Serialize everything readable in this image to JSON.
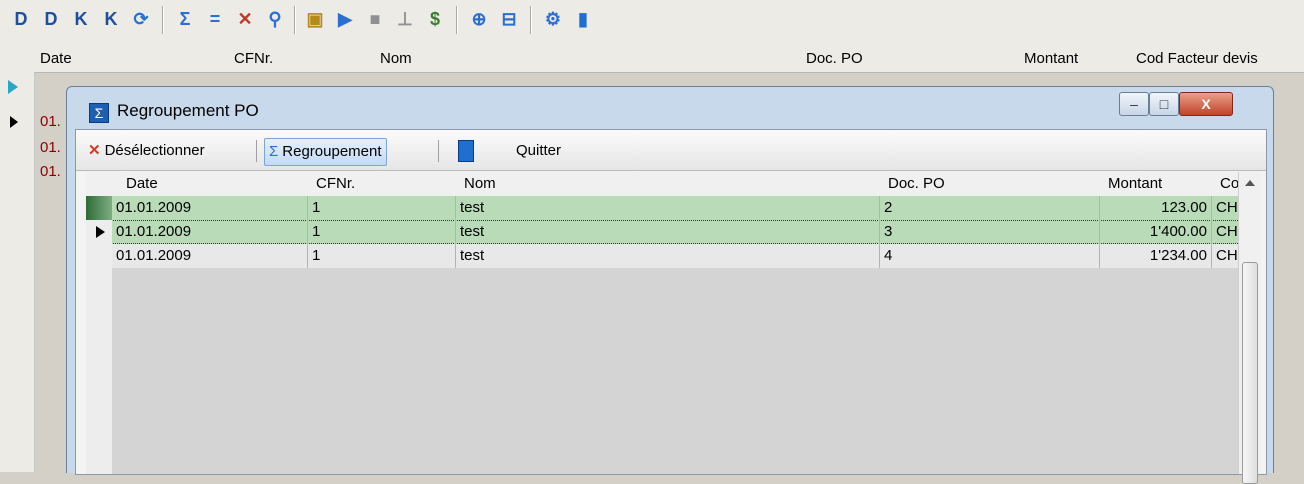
{
  "main_toolbar": {
    "icons": [
      "filter-d-icon",
      "filter-d-alt-icon",
      "filter-k-icon",
      "filter-k-alt-icon",
      "refresh-icon",
      "sum-icon",
      "equals-icon",
      "cross-icon",
      "lookup-icon",
      "export-icon",
      "forward-icon",
      "document-icon",
      "tree-icon",
      "currency-icon",
      "search-globe-icon",
      "search-page-icon",
      "settings-icon",
      "exit-icon"
    ],
    "glyphs": [
      "D",
      "D",
      "K",
      "K",
      "⟳",
      "Σ",
      "=",
      "✕",
      "⚲",
      "▣",
      "▶",
      "■",
      "⊥",
      "$",
      "⊕",
      "⊟",
      "⚙",
      "▮"
    ]
  },
  "back_grid": {
    "columns": [
      "Date",
      "CFNr.",
      "Nom",
      "Doc. PO",
      "Montant",
      "Cod Facteur devis"
    ],
    "rows": [
      "01.",
      "01.",
      "01."
    ]
  },
  "dialog": {
    "title": "Regroupement PO",
    "title_icon": "Σ",
    "controls": {
      "minimize": "–",
      "maximize": "□",
      "close": "X"
    },
    "toolbar": {
      "deselect_icon": "✕",
      "deselect_label": "Désélectionner",
      "regroup_icon": "Σ",
      "regroup_label": "Regroupement",
      "quit_label": "Quitter"
    },
    "grid": {
      "columns": [
        "Date",
        "CFNr.",
        "Nom",
        "Doc. PO",
        "Montant",
        "Cod"
      ],
      "rows": [
        {
          "date": "01.01.2009",
          "cfnr": "1",
          "nom": "test",
          "doc": "2",
          "montant": "123.00",
          "cod": "CHF"
        },
        {
          "date": "01.01.2009",
          "cfnr": "1",
          "nom": "test",
          "doc": "3",
          "montant": "1'400.00",
          "cod": "CHF"
        },
        {
          "date": "01.01.2009",
          "cfnr": "1",
          "nom": "test",
          "doc": "4",
          "montant": "1'234.00",
          "cod": "CHF"
        }
      ]
    }
  },
  "colors": {
    "selected_row": "#b9dbb8",
    "accent": "#1e5fb4",
    "back_row_text": "#8b0000"
  }
}
